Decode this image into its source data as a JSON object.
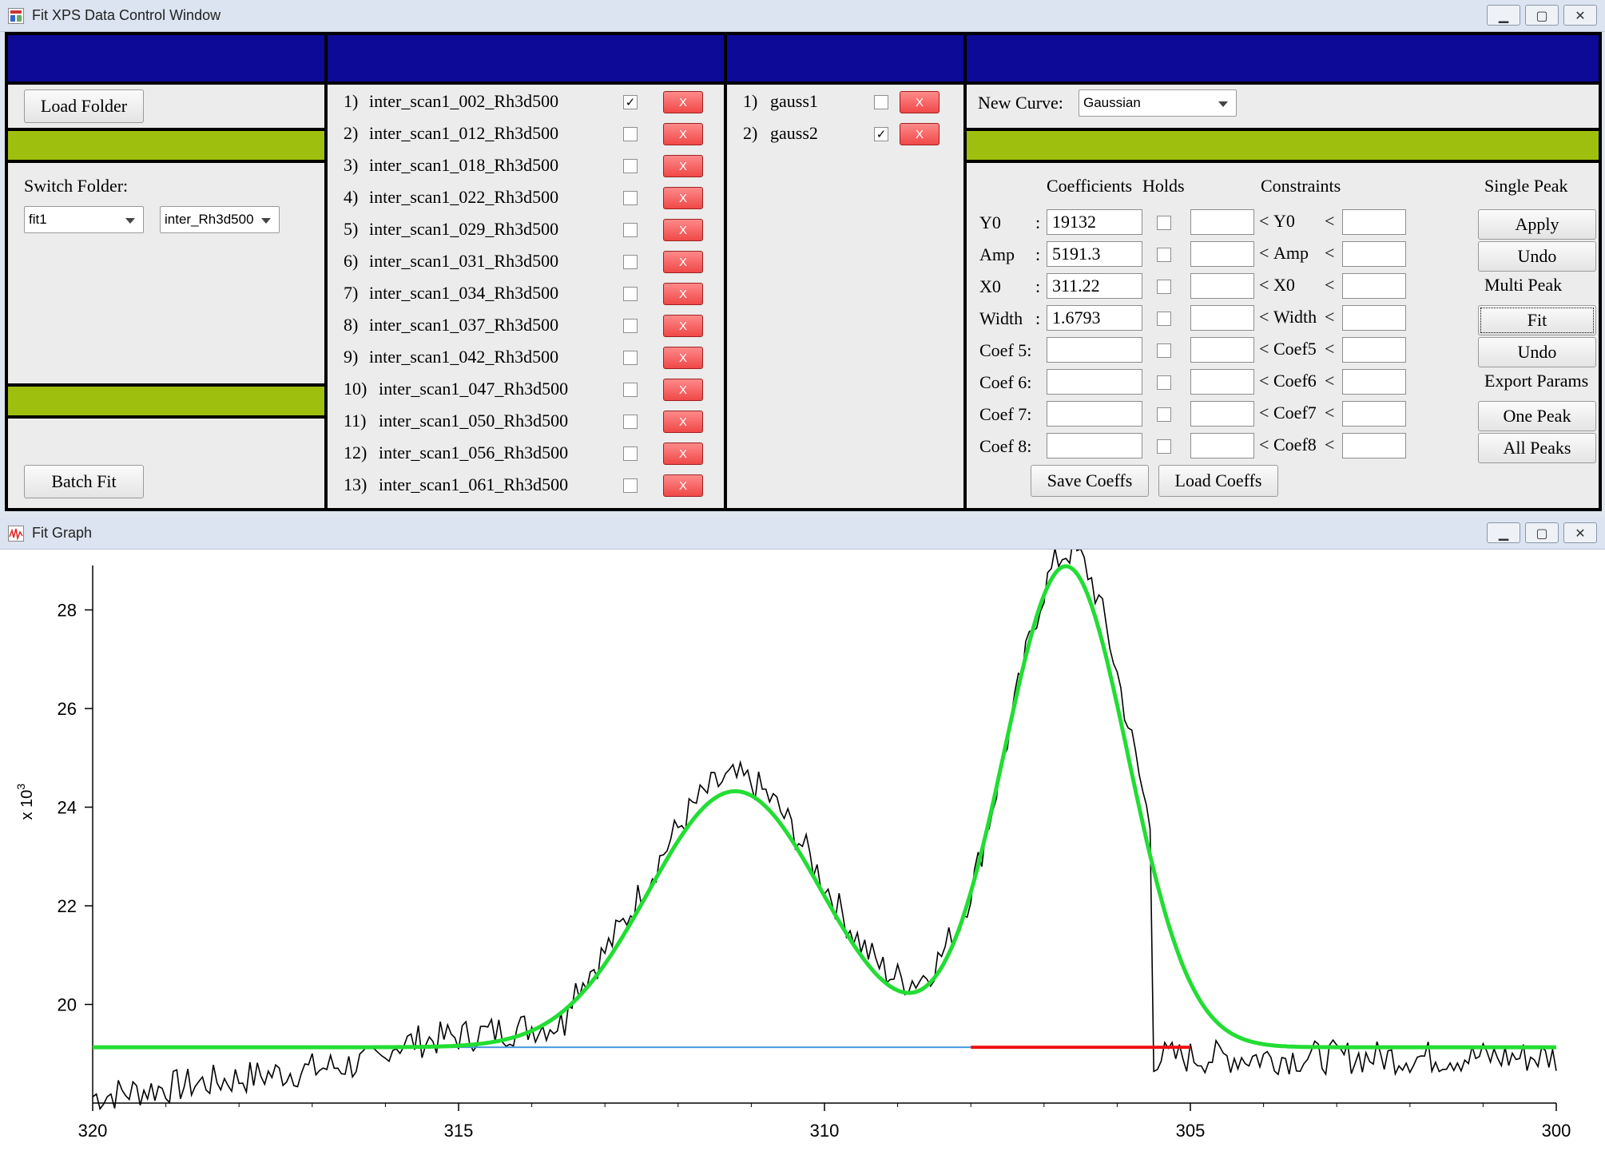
{
  "control_window": {
    "title": "Fit XPS Data Control Window",
    "left_panel": {
      "load_folder_label": "Load Folder",
      "switch_folder_label": "Switch Folder:",
      "folder_select": "fit1",
      "subfolder_select": "inter_Rh3d500",
      "batch_fit_label": "Batch Fit"
    },
    "scans": [
      {
        "index": "1)",
        "name": "inter_scan1_002_Rh3d500",
        "checked": true
      },
      {
        "index": "2)",
        "name": "inter_scan1_012_Rh3d500",
        "checked": false
      },
      {
        "index": "3)",
        "name": "inter_scan1_018_Rh3d500",
        "checked": false
      },
      {
        "index": "4)",
        "name": "inter_scan1_022_Rh3d500",
        "checked": false
      },
      {
        "index": "5)",
        "name": "inter_scan1_029_Rh3d500",
        "checked": false
      },
      {
        "index": "6)",
        "name": "inter_scan1_031_Rh3d500",
        "checked": false
      },
      {
        "index": "7)",
        "name": "inter_scan1_034_Rh3d500",
        "checked": false
      },
      {
        "index": "8)",
        "name": "inter_scan1_037_Rh3d500",
        "checked": false
      },
      {
        "index": "9)",
        "name": "inter_scan1_042_Rh3d500",
        "checked": false
      },
      {
        "index": "10)",
        "name": "inter_scan1_047_Rh3d500",
        "checked": false
      },
      {
        "index": "11)",
        "name": "inter_scan1_050_Rh3d500",
        "checked": false
      },
      {
        "index": "12)",
        "name": "inter_scan1_056_Rh3d500",
        "checked": false
      },
      {
        "index": "13)",
        "name": "inter_scan1_061_Rh3d500",
        "checked": false
      }
    ],
    "delete_label": "X",
    "curves": [
      {
        "index": "1)",
        "name": "gauss1",
        "checked": false
      },
      {
        "index": "2)",
        "name": "gauss2",
        "checked": true
      }
    ],
    "right_panel": {
      "new_curve_label": "New Curve:",
      "new_curve_select": "Gaussian",
      "coefficients_header": "Coefficients",
      "holds_header": "Holds",
      "constraints_header": "Constraints",
      "single_peak_header": "Single Peak",
      "rows": [
        {
          "name": "Y0",
          "sep": ":",
          "value": "19132",
          "cname": "Y0"
        },
        {
          "name": "Amp",
          "sep": ":",
          "value": "5191.3",
          "cname": "Amp"
        },
        {
          "name": "X0",
          "sep": ":",
          "value": "311.22",
          "cname": "X0"
        },
        {
          "name": "Width",
          "sep": ":",
          "value": "1.6793",
          "cname": "Width"
        },
        {
          "name": "Coef 5:",
          "sep": "",
          "value": "",
          "cname": "Coef5"
        },
        {
          "name": "Coef 6:",
          "sep": "",
          "value": "",
          "cname": "Coef6"
        },
        {
          "name": "Coef 7:",
          "sep": "",
          "value": "",
          "cname": "Coef7"
        },
        {
          "name": "Coef 8:",
          "sep": "",
          "value": "",
          "cname": "Coef8"
        }
      ],
      "lt": "<",
      "apply_label": "Apply",
      "undo_label": "Undo",
      "multi_peak_header": "Multi Peak",
      "fit_label": "Fit",
      "undo2_label": "Undo",
      "export_params_header": "Export Params",
      "one_peak_label": "One Peak",
      "all_peaks_label": "All Peaks",
      "save_coeffs_label": "Save Coeffs",
      "load_coeffs_label": "Load Coeffs"
    }
  },
  "graph_window": {
    "title": "Fit Graph"
  },
  "colors": {
    "band_blue": "#0c0a96",
    "band_green": "#9fbf0e",
    "fit_curve": "#22dd33",
    "baseline": "#4499dd",
    "residual": "#ee1111",
    "data_line": "#000000"
  },
  "chart_data": {
    "type": "line",
    "title": "",
    "xlabel": "",
    "ylabel": "x 10³",
    "ylabel_main": "x 10",
    "ylabel_exp": "3",
    "xlim": [
      320,
      300
    ],
    "ylim": [
      18,
      28.9
    ],
    "x_reversed": true,
    "xticks": [
      320,
      315,
      310,
      305,
      300
    ],
    "xticklabels": [
      "320",
      "315",
      "310",
      "305",
      "300"
    ],
    "yticks": [
      20,
      22,
      24,
      26,
      28
    ],
    "yticklabels": [
      "20",
      "22",
      "24",
      "26",
      "28"
    ],
    "grid": false,
    "legend": "none",
    "series": [
      {
        "role": "data",
        "x_range": [
          320,
          300
        ],
        "n_points": 400
      },
      {
        "role": "fit_total",
        "baseline": 19.132,
        "peaks": [
          {
            "center": 311.22,
            "amplitude": 5.1913,
            "width": 1.6793
          },
          {
            "center": 306.7,
            "amplitude": 9.75,
            "width": 1.2
          }
        ]
      },
      {
        "role": "baseline_gauss1",
        "x_range": [
          320,
          308
        ],
        "y": 19.132
      },
      {
        "role": "baseline_gauss2",
        "x_range": [
          308,
          300
        ],
        "y": 19.132
      }
    ]
  }
}
